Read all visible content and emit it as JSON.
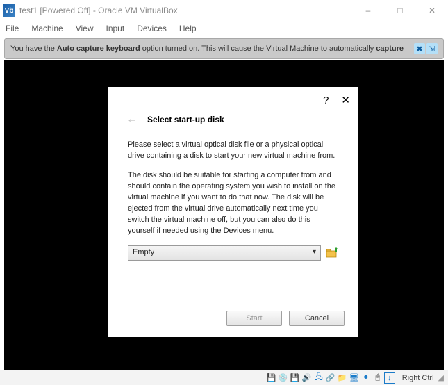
{
  "window": {
    "title": "test1 [Powered Off] - Oracle VM VirtualBox"
  },
  "menu": {
    "file": "File",
    "machine": "Machine",
    "view": "View",
    "input": "Input",
    "devices": "Devices",
    "help": "Help"
  },
  "infobar": {
    "prefix": "You have the ",
    "bold1": "Auto capture keyboard",
    "mid": " option turned on. This will cause the Virtual Machine to automatically ",
    "bold2": "capture"
  },
  "dialog": {
    "title": "Select start-up disk",
    "p1": "Please select a virtual optical disk file or a physical optical drive containing a disk to start your new virtual machine from.",
    "p2": "The disk should be suitable for starting a computer from and should contain the operating system you wish to install on the virtual machine if you want to do that now. The disk will be ejected from the virtual drive automatically next time you switch the virtual machine off, but you can also do this yourself if needed using the Devices menu.",
    "combo_value": "Empty",
    "start": "Start",
    "cancel": "Cancel"
  },
  "status": {
    "host_key": "Right Ctrl"
  }
}
